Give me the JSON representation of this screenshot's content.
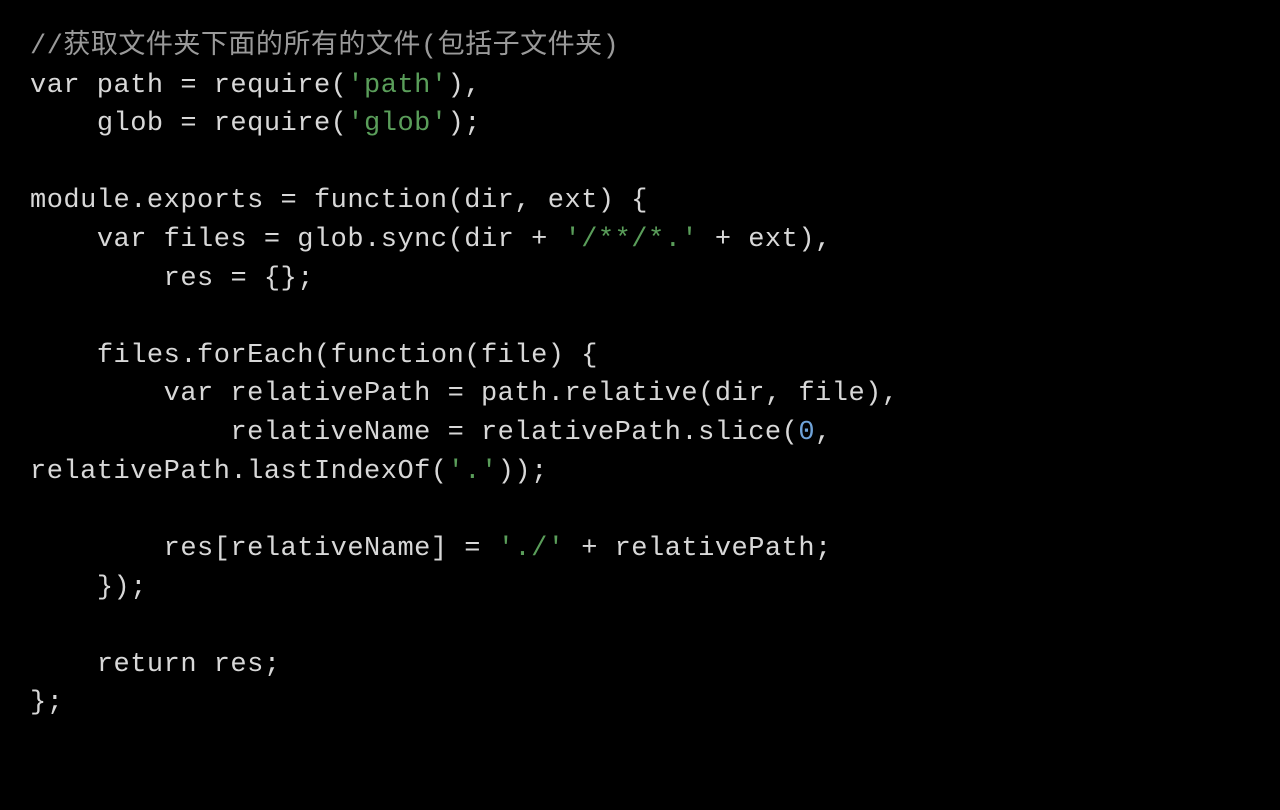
{
  "code": {
    "tokens": [
      {
        "cls": "c",
        "t": "//获取文件夹下面的所有的文件(包括子文件夹)"
      },
      {
        "cls": "nl",
        "t": "\n"
      },
      {
        "cls": "k",
        "t": "var"
      },
      {
        "cls": "o",
        "t": " path "
      },
      {
        "cls": "o",
        "t": "="
      },
      {
        "cls": "o",
        "t": " "
      },
      {
        "cls": "i",
        "t": "require"
      },
      {
        "cls": "o",
        "t": "("
      },
      {
        "cls": "s",
        "t": "'path'"
      },
      {
        "cls": "o",
        "t": "),"
      },
      {
        "cls": "nl",
        "t": "\n"
      },
      {
        "cls": "o",
        "t": "    glob "
      },
      {
        "cls": "o",
        "t": "="
      },
      {
        "cls": "o",
        "t": " "
      },
      {
        "cls": "i",
        "t": "require"
      },
      {
        "cls": "o",
        "t": "("
      },
      {
        "cls": "s",
        "t": "'glob'"
      },
      {
        "cls": "o",
        "t": ");"
      },
      {
        "cls": "nl",
        "t": "\n"
      },
      {
        "cls": "nl",
        "t": "\n"
      },
      {
        "cls": "i",
        "t": "module"
      },
      {
        "cls": "o",
        "t": "."
      },
      {
        "cls": "i",
        "t": "exports"
      },
      {
        "cls": "o",
        "t": " = "
      },
      {
        "cls": "k",
        "t": "function"
      },
      {
        "cls": "o",
        "t": "("
      },
      {
        "cls": "i",
        "t": "dir"
      },
      {
        "cls": "o",
        "t": ", "
      },
      {
        "cls": "i",
        "t": "ext"
      },
      {
        "cls": "o",
        "t": ") {"
      },
      {
        "cls": "nl",
        "t": "\n"
      },
      {
        "cls": "o",
        "t": "    "
      },
      {
        "cls": "k",
        "t": "var"
      },
      {
        "cls": "o",
        "t": " files "
      },
      {
        "cls": "o",
        "t": "="
      },
      {
        "cls": "o",
        "t": " "
      },
      {
        "cls": "i",
        "t": "glob"
      },
      {
        "cls": "o",
        "t": "."
      },
      {
        "cls": "i",
        "t": "sync"
      },
      {
        "cls": "o",
        "t": "("
      },
      {
        "cls": "i",
        "t": "dir"
      },
      {
        "cls": "o",
        "t": " + "
      },
      {
        "cls": "s",
        "t": "'/**/*.'"
      },
      {
        "cls": "o",
        "t": " + "
      },
      {
        "cls": "i",
        "t": "ext"
      },
      {
        "cls": "o",
        "t": "),"
      },
      {
        "cls": "nl",
        "t": "\n"
      },
      {
        "cls": "o",
        "t": "        res "
      },
      {
        "cls": "o",
        "t": "="
      },
      {
        "cls": "o",
        "t": " {};"
      },
      {
        "cls": "nl",
        "t": "\n"
      },
      {
        "cls": "nl",
        "t": "\n"
      },
      {
        "cls": "o",
        "t": "    "
      },
      {
        "cls": "i",
        "t": "files"
      },
      {
        "cls": "o",
        "t": "."
      },
      {
        "cls": "i",
        "t": "forEach"
      },
      {
        "cls": "o",
        "t": "("
      },
      {
        "cls": "k",
        "t": "function"
      },
      {
        "cls": "o",
        "t": "("
      },
      {
        "cls": "i",
        "t": "file"
      },
      {
        "cls": "o",
        "t": ") {"
      },
      {
        "cls": "nl",
        "t": "\n"
      },
      {
        "cls": "o",
        "t": "        "
      },
      {
        "cls": "k",
        "t": "var"
      },
      {
        "cls": "o",
        "t": " relativePath "
      },
      {
        "cls": "o",
        "t": "="
      },
      {
        "cls": "o",
        "t": " "
      },
      {
        "cls": "i",
        "t": "path"
      },
      {
        "cls": "o",
        "t": "."
      },
      {
        "cls": "i",
        "t": "relative"
      },
      {
        "cls": "o",
        "t": "("
      },
      {
        "cls": "i",
        "t": "dir"
      },
      {
        "cls": "o",
        "t": ", "
      },
      {
        "cls": "i",
        "t": "file"
      },
      {
        "cls": "o",
        "t": "),"
      },
      {
        "cls": "nl",
        "t": "\n"
      },
      {
        "cls": "o",
        "t": "            relativeName "
      },
      {
        "cls": "o",
        "t": "="
      },
      {
        "cls": "o",
        "t": " "
      },
      {
        "cls": "i",
        "t": "relativePath"
      },
      {
        "cls": "o",
        "t": "."
      },
      {
        "cls": "i",
        "t": "slice"
      },
      {
        "cls": "o",
        "t": "("
      },
      {
        "cls": "n",
        "t": "0"
      },
      {
        "cls": "o",
        "t": ", "
      },
      {
        "cls": "i",
        "t": "relativePath"
      },
      {
        "cls": "o",
        "t": "."
      },
      {
        "cls": "i",
        "t": "lastIndexOf"
      },
      {
        "cls": "o",
        "t": "("
      },
      {
        "cls": "s",
        "t": "'.'"
      },
      {
        "cls": "o",
        "t": "));"
      },
      {
        "cls": "nl",
        "t": "\n"
      },
      {
        "cls": "nl",
        "t": "\n"
      },
      {
        "cls": "o",
        "t": "        res["
      },
      {
        "cls": "i",
        "t": "relativeName"
      },
      {
        "cls": "o",
        "t": "] "
      },
      {
        "cls": "o",
        "t": "="
      },
      {
        "cls": "o",
        "t": " "
      },
      {
        "cls": "s",
        "t": "'./'"
      },
      {
        "cls": "o",
        "t": " + "
      },
      {
        "cls": "i",
        "t": "relativePath"
      },
      {
        "cls": "o",
        "t": ";"
      },
      {
        "cls": "nl",
        "t": "\n"
      },
      {
        "cls": "o",
        "t": "    });"
      },
      {
        "cls": "nl",
        "t": "\n"
      },
      {
        "cls": "nl",
        "t": "\n"
      },
      {
        "cls": "o",
        "t": "    "
      },
      {
        "cls": "k",
        "t": "return"
      },
      {
        "cls": "o",
        "t": " res;"
      },
      {
        "cls": "nl",
        "t": "\n"
      },
      {
        "cls": "o",
        "t": "};"
      }
    ]
  }
}
